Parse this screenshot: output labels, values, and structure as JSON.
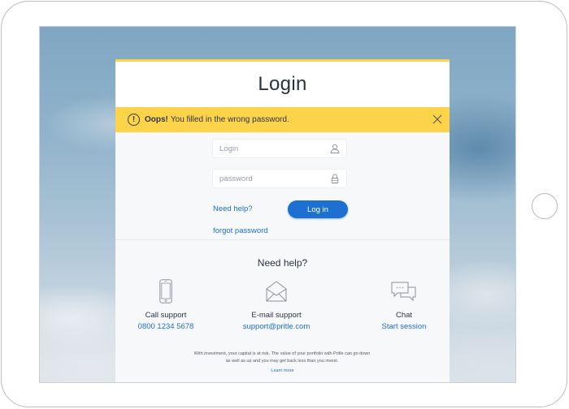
{
  "page": {
    "title": "Login"
  },
  "alert": {
    "icon": "exclamation-circle-icon",
    "strong": "Oops!",
    "message": "You filled in the wrong password.",
    "close_icon": "close-icon",
    "color": "#fdd34a"
  },
  "form": {
    "login_placeholder": "Login",
    "login_value": "",
    "login_icon": "user-icon",
    "password_placeholder": "password",
    "password_value": "",
    "password_icon": "lock-icon",
    "need_help_link": "Need help?",
    "login_button": "Log in",
    "forgot_link": "forgot password"
  },
  "help": {
    "title": "Need help?",
    "options": [
      {
        "icon": "phone-icon",
        "label": "Call support",
        "link": "0800 1234 5678"
      },
      {
        "icon": "envelope-icon",
        "label": "E-mail support",
        "link": "support@pritle.com"
      },
      {
        "icon": "chat-icon",
        "label": "Chat",
        "link": "Start session"
      }
    ],
    "disclaimer": "With investment, your capital is at risk. The value of your portfolio with Pritle can go down as well as up and you may get back less than you invest.",
    "learn_more": "Learn more"
  },
  "colors": {
    "accent": "#1d6fd1",
    "alert": "#fdd34a",
    "text": "#2e3440"
  }
}
